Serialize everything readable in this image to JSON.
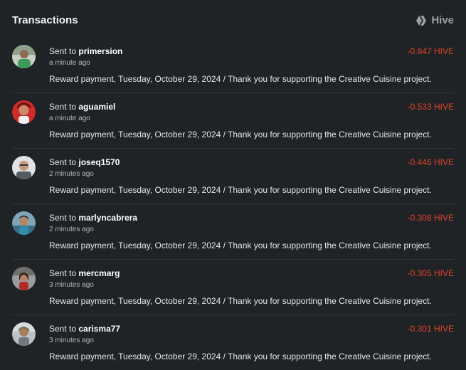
{
  "header": {
    "title": "Transactions",
    "brand_label": "Hive",
    "brand_icon": "hive-logo-icon"
  },
  "colors": {
    "background": "#1f2326",
    "amount_negative": "#e2432a",
    "divider": "#32373b"
  },
  "transactions": [
    {
      "prefix": "Sent to",
      "username": "primersion",
      "amount": "-0.847 HIVE",
      "time": "a minute ago",
      "memo": "Reward payment, Tuesday, October 29, 2024 / Thank you for supporting the Creative Cuisine project."
    },
    {
      "prefix": "Sent to",
      "username": "aguamiel",
      "amount": "-0.533 HIVE",
      "time": "a minute ago",
      "memo": "Reward payment, Tuesday, October 29, 2024 / Thank you for supporting the Creative Cuisine project."
    },
    {
      "prefix": "Sent to",
      "username": "joseq1570",
      "amount": "-0.446 HIVE",
      "time": "2 minutes ago",
      "memo": "Reward payment, Tuesday, October 29, 2024 / Thank you for supporting the Creative Cuisine project."
    },
    {
      "prefix": "Sent to",
      "username": "marlyncabrera",
      "amount": "-0.308 HIVE",
      "time": "2 minutes ago",
      "memo": "Reward payment, Tuesday, October 29, 2024 / Thank you for supporting the Creative Cuisine project."
    },
    {
      "prefix": "Sent to",
      "username": "mercmarg",
      "amount": "-0.305 HIVE",
      "time": "3 minutes ago",
      "memo": "Reward payment, Tuesday, October 29, 2024 / Thank you for supporting the Creative Cuisine project."
    },
    {
      "prefix": "Sent to",
      "username": "carisma77",
      "amount": "-0.301 HIVE",
      "time": "3 minutes ago",
      "memo": "Reward payment, Tuesday, October 29, 2024 / Thank you for supporting the Creative Cuisine project."
    }
  ]
}
